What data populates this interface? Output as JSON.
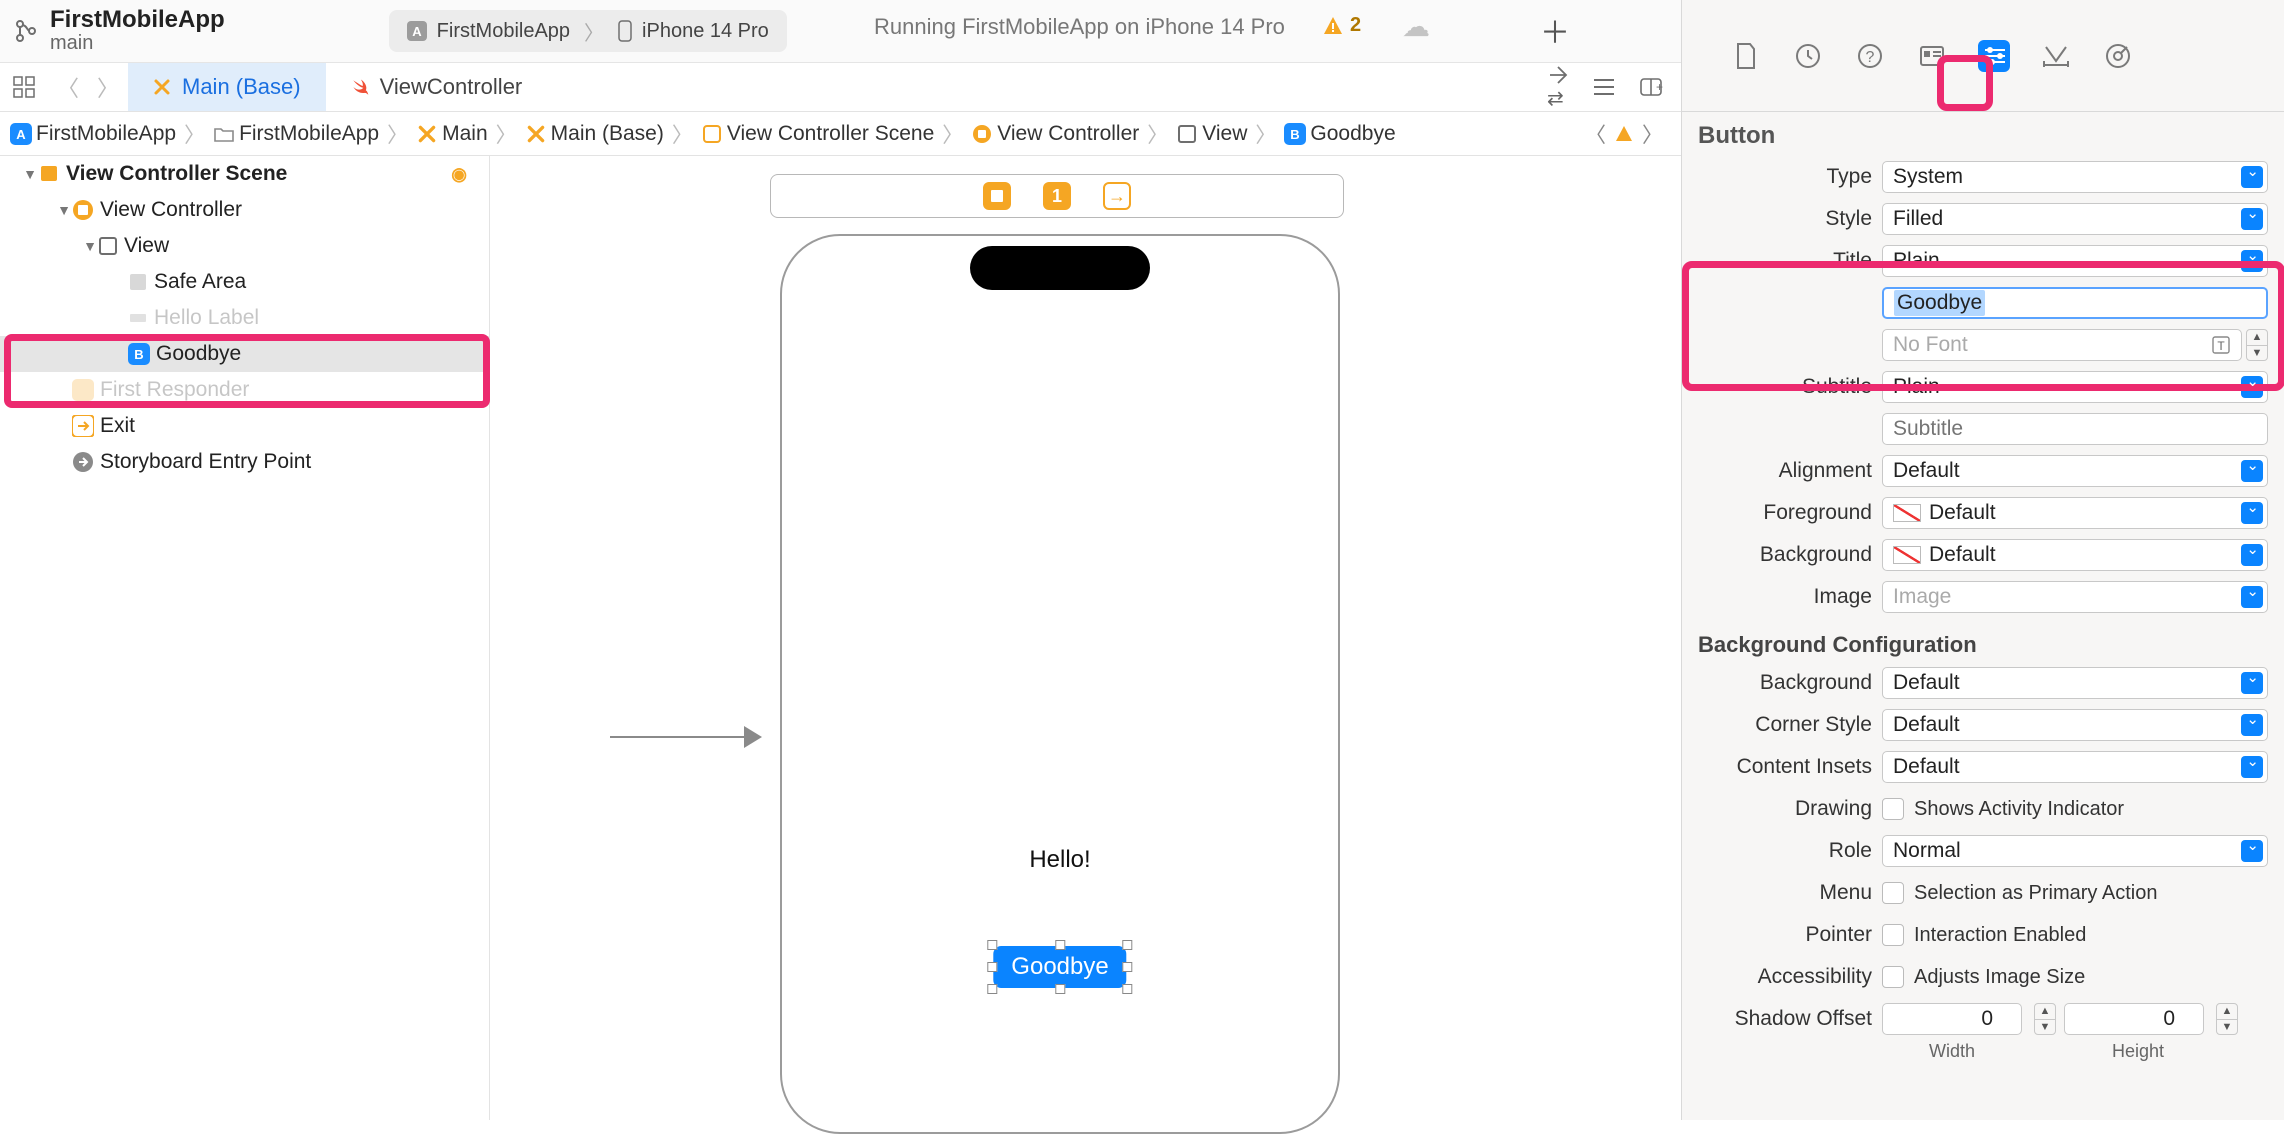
{
  "toolbar": {
    "project": "FirstMobileApp",
    "branch": "main",
    "scheme_app": "FirstMobileApp",
    "scheme_device": "iPhone 14 Pro",
    "status": "Running FirstMobileApp on iPhone 14 Pro",
    "warn_count": "2"
  },
  "tabs": {
    "t0": "Main (Base)",
    "t1": "ViewController"
  },
  "breadcrumb": {
    "b0": "FirstMobileApp",
    "b1": "FirstMobileApp",
    "b2": "Main",
    "b3": "Main (Base)",
    "b4": "View Controller Scene",
    "b5": "View Controller",
    "b6": "View",
    "b7": "Goodbye"
  },
  "outline": {
    "scene": "View Controller Scene",
    "vc": "View Controller",
    "view": "View",
    "safe": "Safe Area",
    "hello": "Hello Label",
    "goodbye": "Goodbye",
    "first": "First Responder",
    "exit": "Exit",
    "entry": "Storyboard Entry Point"
  },
  "canvas": {
    "hello": "Hello!",
    "button": "Goodbye"
  },
  "inspector": {
    "header": "Button",
    "type_l": "Type",
    "type_v": "System",
    "style_l": "Style",
    "style_v": "Filled",
    "title_l": "Title",
    "title_v": "Plain",
    "title_text": "Goodbye",
    "font_v": "No Font",
    "subtitle_l": "Subtitle",
    "subtitle_v": "Plain",
    "subtitle_ph": "Subtitle",
    "align_l": "Alignment",
    "align_v": "Default",
    "fg_l": "Foreground",
    "fg_v": "Default",
    "bg_l": "Background",
    "bg_v": "Default",
    "img_l": "Image",
    "img_ph": "Image",
    "bgconf_h": "Background Configuration",
    "bgc_l": "Background",
    "bgc_v": "Default",
    "corner_l": "Corner Style",
    "corner_v": "Default",
    "insets_l": "Content Insets",
    "insets_v": "Default",
    "draw_l": "Drawing",
    "draw_v": "Shows Activity Indicator",
    "role_l": "Role",
    "role_v": "Normal",
    "menu_l": "Menu",
    "menu_v": "Selection as Primary Action",
    "ptr_l": "Pointer",
    "ptr_v": "Interaction Enabled",
    "acc_l": "Accessibility",
    "acc_v": "Adjusts Image Size",
    "shadow_l": "Shadow Offset",
    "shadow_w": "0",
    "shadow_h": "0",
    "w_lbl": "Width",
    "h_lbl": "Height"
  }
}
